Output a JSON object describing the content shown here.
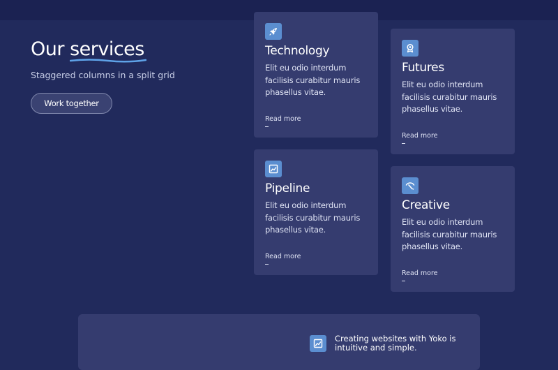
{
  "hero": {
    "title_prefix": "Our ",
    "title_accent": "services",
    "subtitle": "Staggered columns in a split grid",
    "cta_label": "Work together"
  },
  "cards": [
    {
      "icon": "rocket-icon",
      "title": "Technology",
      "description": "Elit eu odio interdum facilisis curabitur mauris phasellus vitae.",
      "link": "Read more"
    },
    {
      "icon": "badge-icon",
      "title": "Futures",
      "description": "Elit eu odio interdum facilisis curabitur mauris phasellus vitae.",
      "link": "Read more"
    },
    {
      "icon": "chart-icon",
      "title": "Pipeline",
      "description": "Elit eu odio interdum facilisis curabitur mauris phasellus vitae.",
      "link": "Read more"
    },
    {
      "icon": "paint-icon",
      "title": "Creative",
      "description": "Elit eu odio interdum facilisis curabitur mauris phasellus vitae.",
      "link": "Read more"
    }
  ],
  "bottom": {
    "icon": "chart-icon",
    "text": "Creating websites with Yoko is intuitive and simple."
  },
  "colors": {
    "background": "#212a5c",
    "card": "#353c6f",
    "icon_tile": "#5b8ed0",
    "accent_underline": "#5fa3e8"
  }
}
